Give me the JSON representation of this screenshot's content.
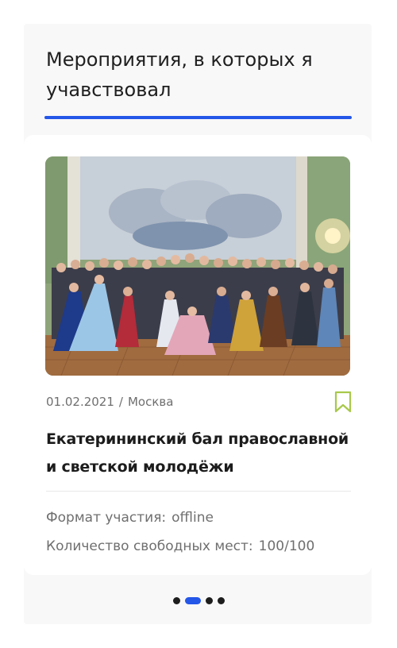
{
  "section": {
    "title": "Мероприятия, в которых я учавствовал",
    "accent_color": "#2456e8"
  },
  "event": {
    "date": "01.02.2021",
    "separator": "/",
    "city": "Москва",
    "title": "Екатерининский бал православной и светской молодёжи",
    "image": "group-photo",
    "bookmark_icon": "bookmark-icon",
    "bookmark_color": "#a8c84a",
    "format_label": "Формат участия:",
    "format_value": "offline",
    "seats_label": "Количество свободных мест:",
    "seats_value": "100/100"
  },
  "carousel": {
    "total": 4,
    "active_index": 1
  }
}
